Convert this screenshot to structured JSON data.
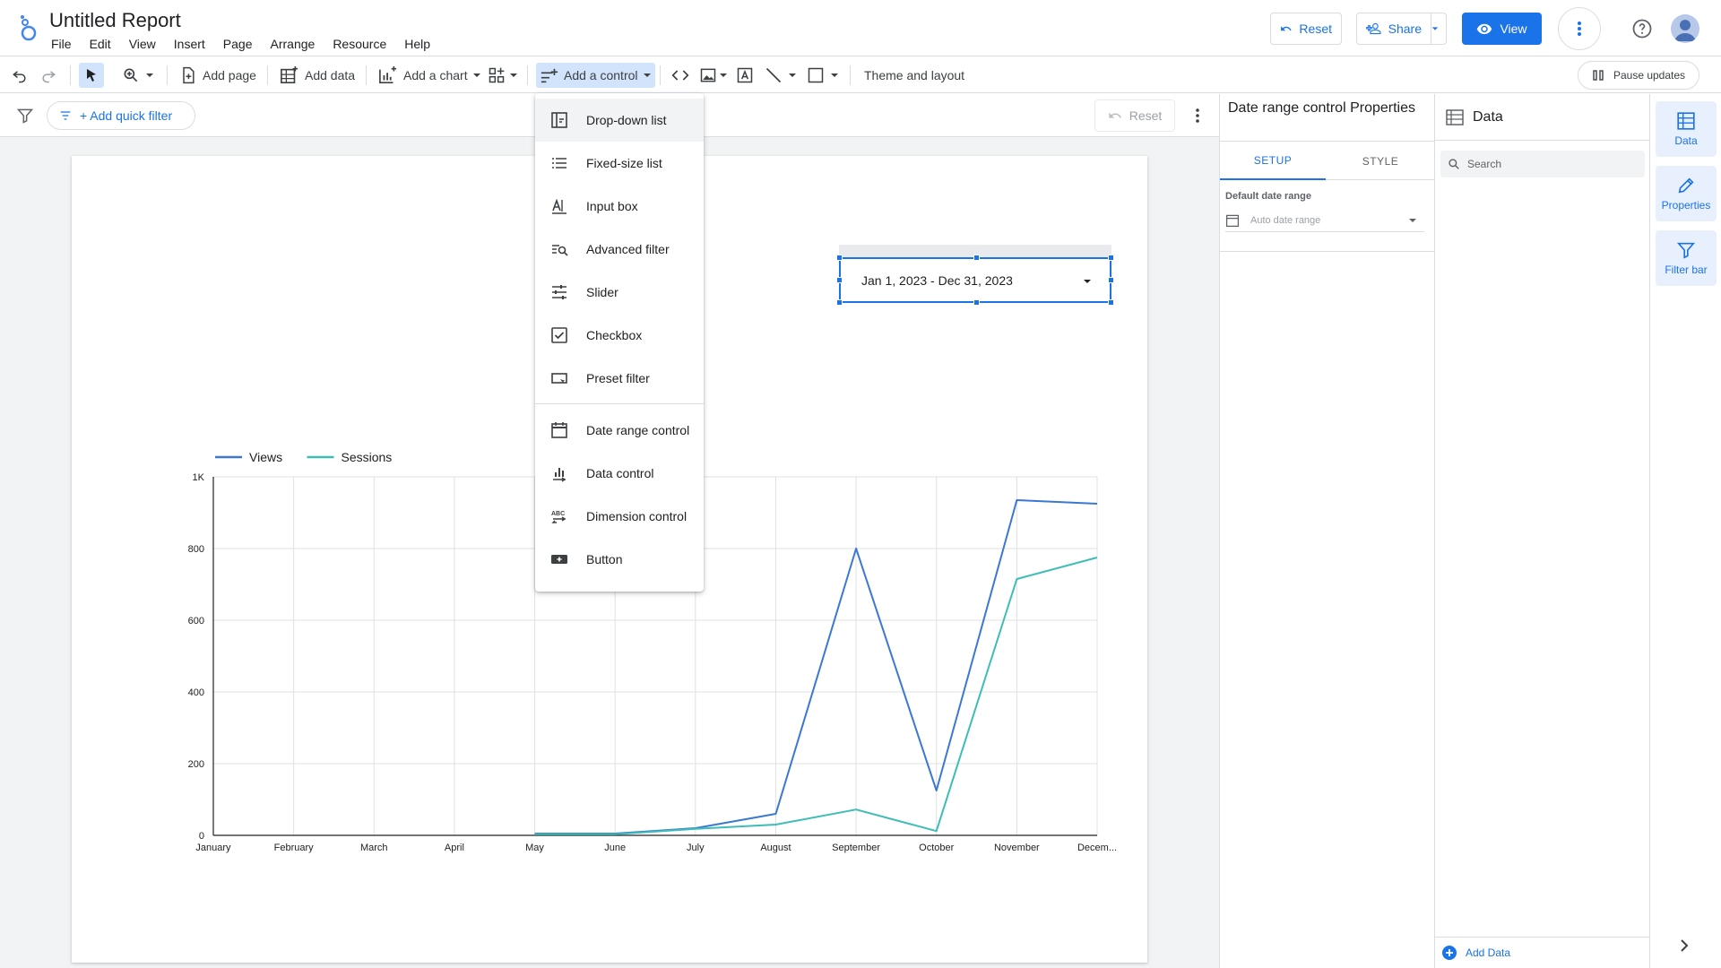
{
  "header": {
    "title": "Untitled Report",
    "menus": [
      "File",
      "Edit",
      "View",
      "Insert",
      "Page",
      "Arrange",
      "Resource",
      "Help"
    ],
    "reset_label": "Reset",
    "share_label": "Share",
    "view_label": "View"
  },
  "toolbar": {
    "add_page": "Add page",
    "add_data": "Add data",
    "add_chart": "Add a chart",
    "add_control": "Add a control",
    "theme_layout": "Theme and layout",
    "pause_updates": "Pause updates"
  },
  "filter_bar": {
    "add_quick_filter": "+ Add quick filter",
    "reset": "Reset"
  },
  "control_menu": {
    "items": [
      {
        "label": "Drop-down list",
        "icon": "dropdown-list-icon"
      },
      {
        "label": "Fixed-size list",
        "icon": "list-icon"
      },
      {
        "label": "Input box",
        "icon": "input-box-icon"
      },
      {
        "label": "Advanced filter",
        "icon": "advanced-filter-icon"
      },
      {
        "label": "Slider",
        "icon": "slider-icon"
      },
      {
        "label": "Checkbox",
        "icon": "checkbox-icon"
      },
      {
        "label": "Preset filter",
        "icon": "preset-filter-icon"
      }
    ],
    "items2": [
      {
        "label": "Date range control",
        "icon": "calendar-icon"
      },
      {
        "label": "Data control",
        "icon": "data-control-icon"
      },
      {
        "label": "Dimension control",
        "icon": "dimension-control-icon"
      },
      {
        "label": "Button",
        "icon": "button-icon"
      }
    ]
  },
  "date_control": {
    "value": "Jan 1, 2023 - Dec 31, 2023"
  },
  "properties_panel": {
    "title": "Date range control Properties",
    "tab_setup": "SETUP",
    "tab_style": "STYLE",
    "default_date_range_label": "Default date range",
    "default_date_range_value": "Auto date range"
  },
  "data_panel": {
    "title": "Data",
    "search_placeholder": "Search",
    "add_data": "Add Data"
  },
  "right_rail": {
    "data": "Data",
    "properties": "Properties",
    "filter_bar": "Filter bar"
  },
  "colors": {
    "accent": "#1a73e8",
    "views_line": "#3b78d4",
    "sessions_line": "#3dbdb6"
  },
  "chart_data": {
    "type": "line",
    "categories": [
      "January",
      "February",
      "March",
      "April",
      "May",
      "June",
      "July",
      "August",
      "September",
      "October",
      "November",
      "Decem..."
    ],
    "series": [
      {
        "name": "Views",
        "values": [
          null,
          null,
          null,
          null,
          5,
          5,
          20,
          60,
          800,
          125,
          935,
          925
        ]
      },
      {
        "name": "Sessions",
        "values": [
          null,
          null,
          null,
          null,
          3,
          3,
          18,
          30,
          72,
          12,
          715,
          775
        ]
      }
    ],
    "ylim": [
      0,
      1000
    ],
    "yticks": [
      0,
      200,
      400,
      600,
      800,
      1000
    ],
    "ytick_labels": [
      "0",
      "200",
      "400",
      "600",
      "800",
      "1K"
    ],
    "legend": "top-left",
    "grid": true
  }
}
